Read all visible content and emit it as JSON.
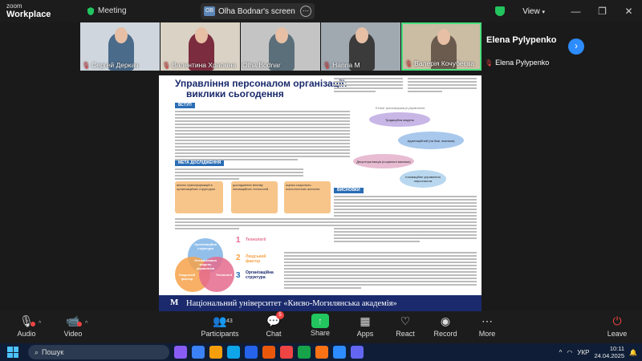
{
  "app": {
    "logo_line1": "zoom",
    "logo_line2": "Workplace",
    "meeting_label": "Meeting"
  },
  "screen_share": {
    "badge": "OB",
    "label": "Olha Bodnar's screen"
  },
  "top_right": {
    "view_label": "View"
  },
  "participants": [
    {
      "name": "Сергей Деркач",
      "muted": true,
      "shirt": "#4a6b8a",
      "bg": "#cfd6dd"
    },
    {
      "name": "Валентина Храпкіна",
      "muted": true,
      "shirt": "#7b2c3e",
      "bg": "#d9d2c5"
    },
    {
      "name": "Olha Bodnar",
      "muted": false,
      "shirt": "#5b6f7a",
      "bg": "#c4c4c4"
    },
    {
      "name": "Hanna M",
      "muted": true,
      "shirt": "#3b3b3b",
      "bg": "#a0a8b0"
    },
    {
      "name": "Валерія Кочубеєва",
      "muted": true,
      "shirt": "#6b5a4e",
      "bg": "#cbbca4"
    }
  ],
  "speaker": {
    "name_big": "Elena Pylypenko",
    "name_small": "Elena Pylypenko"
  },
  "slide": {
    "title_line1": "Управління персоналом організації:",
    "title_line2": "виклики сьогодення",
    "sec_intro": "ВСТУП",
    "sec_goal": "МЕТА ДОСЛІДЖЕННЯ",
    "sec_findings": "ВИСНОВКИ",
    "flow_title": "Етапи трансформації управління",
    "oval1": "Традиційна модель",
    "oval2": "Адаптаційний (на базі, виклики)",
    "oval3": "Децентралізація (соціальні виклики)",
    "oval4": "Інноваційне управління персоналом",
    "box1": "аналіз трансформацій в організаційних структурах",
    "box2": "дослідження впливу інноваційних технологій",
    "box3": "оцінка соціально-психологічних аспектів",
    "venn_center": "Оптимізована модель управління",
    "venn_top": "Організаційна структура",
    "venn_left": "Людський фактор",
    "venn_right": "Технології",
    "legend1_num": "1",
    "legend1": "Технології",
    "legend2_num": "2",
    "legend2": "Людський фактор",
    "legend3_num": "3",
    "legend3": "Організаційна структура",
    "footer": "Національний університет «Києво-Могилянська академія»"
  },
  "controls": {
    "audio": "Audio",
    "video": "Video",
    "participants": "Participants",
    "participants_count": "43",
    "chat": "Chat",
    "chat_badge": "5",
    "share": "Share",
    "apps": "Apps",
    "react": "React",
    "record": "Record",
    "more": "More",
    "leave": "Leave"
  },
  "taskbar": {
    "search_placeholder": "Пошук",
    "lang": "УКР",
    "time": "10:11",
    "date": "24.04.2025"
  }
}
